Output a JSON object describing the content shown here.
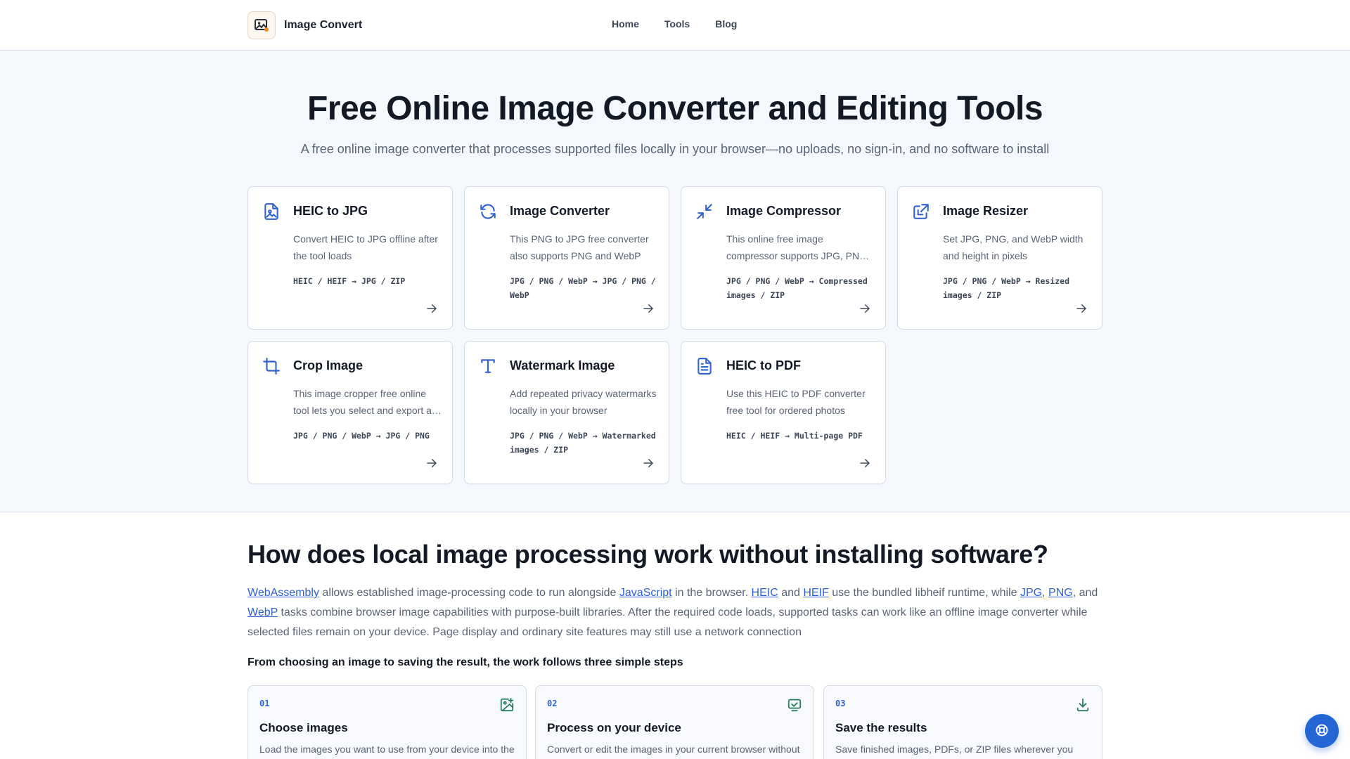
{
  "header": {
    "brand": "Image Convert",
    "nav": [
      {
        "label": "Home"
      },
      {
        "label": "Tools"
      },
      {
        "label": "Blog"
      }
    ]
  },
  "hero": {
    "title": "Free Online Image Converter and Editing Tools",
    "subtitle": "A free online image converter that processes supported files locally in your browser—no uploads, no sign-in, and no software to install"
  },
  "tools": [
    {
      "icon": "heic-file-icon",
      "title": "HEIC to JPG",
      "description": "Convert HEIC to JPG offline after the tool loads",
      "formats": "HEIC / HEIF → JPG / ZIP"
    },
    {
      "icon": "refresh-icon",
      "title": "Image Converter",
      "description": "This PNG to JPG free converter also supports PNG and WebP",
      "formats": "JPG / PNG / WebP → JPG / PNG / WebP"
    },
    {
      "icon": "compress-icon",
      "title": "Image Compressor",
      "description": "This online free image compressor supports JPG, PNG, and WebP",
      "formats": "JPG / PNG / WebP → Compressed images / ZIP"
    },
    {
      "icon": "resize-icon",
      "title": "Image Resizer",
      "description": "Set JPG, PNG, and WebP width and height in pixels",
      "formats": "JPG / PNG / WebP → Resized images / ZIP"
    },
    {
      "icon": "crop-icon",
      "title": "Crop Image",
      "description": "This image cropper free online tool lets you select and export a region",
      "formats": "JPG / PNG / WebP → JPG / PNG"
    },
    {
      "icon": "text-icon",
      "title": "Watermark Image",
      "description": "Add repeated privacy watermarks locally in your browser",
      "formats": "JPG / PNG / WebP → Watermarked images / ZIP"
    },
    {
      "icon": "document-icon",
      "title": "HEIC to PDF",
      "description": "Use this HEIC to PDF converter free tool for ordered photos",
      "formats": "HEIC / HEIF → Multi-page PDF"
    }
  ],
  "how": {
    "title": "How does local image processing work without installing software?",
    "body": {
      "webassembly": "WebAssembly",
      "t1": " allows established image-processing code to run alongside ",
      "javascript": "JavaScript",
      "t2": " in the browser. ",
      "heic": "HEIC",
      "t3": " and ",
      "heif": "HEIF",
      "t4": " use the bundled libheif runtime, while ",
      "jpg": "JPG",
      "t5": ", ",
      "png": "PNG",
      "t6": ", and ",
      "webp": "WebP",
      "t7": " tasks combine browser image capabilities with purpose-built libraries. After the required code loads, supported tasks can work like an offline image converter while selected files remain on your device. Page display and ordinary site features may still use a network connection"
    },
    "steps_intro": "From choosing an image to saving the result, the work follows three simple steps",
    "steps": [
      {
        "num": "01",
        "icon": "add-image-icon",
        "title": "Choose images",
        "description": "Load the images you want to use from your device into the"
      },
      {
        "num": "02",
        "icon": "monitor-check-icon",
        "title": "Process on your device",
        "description": "Convert or edit the images in your current browser without"
      },
      {
        "num": "03",
        "icon": "download-icon",
        "title": "Save the results",
        "description": "Save finished images, PDFs, or ZIP files wherever you"
      }
    ]
  },
  "help_button": {
    "icon": "lifebuoy-icon"
  }
}
